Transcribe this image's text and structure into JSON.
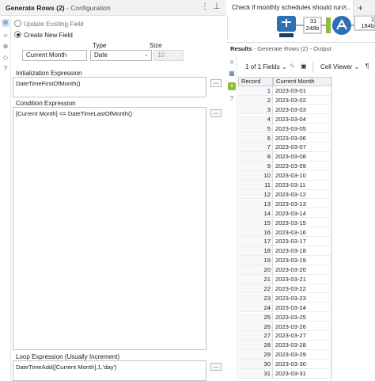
{
  "config": {
    "title_tool": "Generate Rows (2)",
    "title_sep": " - ",
    "title_section": "Configuration",
    "radio_update": "Update Existing Field",
    "radio_create": "Create New  Field",
    "col_type": "Type",
    "col_size": "Size",
    "field_name": "Current Month",
    "field_type": "Date",
    "field_size": "10",
    "init_label": "Initialization Expression",
    "init_expr": "DateTimeFirstOfMonth()",
    "cond_label": "Condition Expression",
    "cond_expr": "[Current Month] <= DateTimeLastOfMonth()",
    "loop_label": "Loop Expression (Usually Increment)",
    "loop_expr": "DateTimeAdd([Current Month],1,'day')",
    "dots": "..."
  },
  "workflow_tab": {
    "label": "Check if monthly schedules should run....",
    "close": "×",
    "add": "+"
  },
  "canvas": {
    "conn1_top": "31",
    "conn1_bot": "248b",
    "conn2_top": "1",
    "conn2_bot": "184b"
  },
  "results": {
    "title": "Results",
    "sep": " - ",
    "source": "Generate Rows (2)",
    "suffix": " - Output",
    "fields_label": "1 of 1 Fields",
    "viewer_label": "Cell Viewer",
    "columns": [
      "Record",
      "Current Month"
    ],
    "rows": [
      [
        "1",
        "2023-03-01"
      ],
      [
        "2",
        "2023-03-02"
      ],
      [
        "3",
        "2023-03-03"
      ],
      [
        "4",
        "2023-03-04"
      ],
      [
        "5",
        "2023-03-05"
      ],
      [
        "6",
        "2023-03-06"
      ],
      [
        "7",
        "2023-03-07"
      ],
      [
        "8",
        "2023-03-08"
      ],
      [
        "9",
        "2023-03-09"
      ],
      [
        "10",
        "2023-03-10"
      ],
      [
        "11",
        "2023-03-11"
      ],
      [
        "12",
        "2023-03-12"
      ],
      [
        "13",
        "2023-03-13"
      ],
      [
        "14",
        "2023-03-14"
      ],
      [
        "15",
        "2023-03-15"
      ],
      [
        "16",
        "2023-03-16"
      ],
      [
        "17",
        "2023-03-17"
      ],
      [
        "18",
        "2023-03-18"
      ],
      [
        "19",
        "2023-03-19"
      ],
      [
        "20",
        "2023-03-20"
      ],
      [
        "21",
        "2023-03-21"
      ],
      [
        "22",
        "2023-03-22"
      ],
      [
        "23",
        "2023-03-23"
      ],
      [
        "24",
        "2023-03-24"
      ],
      [
        "25",
        "2023-03-25"
      ],
      [
        "26",
        "2023-03-26"
      ],
      [
        "27",
        "2023-03-27"
      ],
      [
        "28",
        "2023-03-28"
      ],
      [
        "29",
        "2023-03-29"
      ],
      [
        "30",
        "2023-03-30"
      ],
      [
        "31",
        "2023-03-31"
      ]
    ]
  },
  "colors": {
    "accent": "#1b3d73",
    "tool_blue": "#2f6fb5",
    "tool_green": "#8fbf3a"
  }
}
